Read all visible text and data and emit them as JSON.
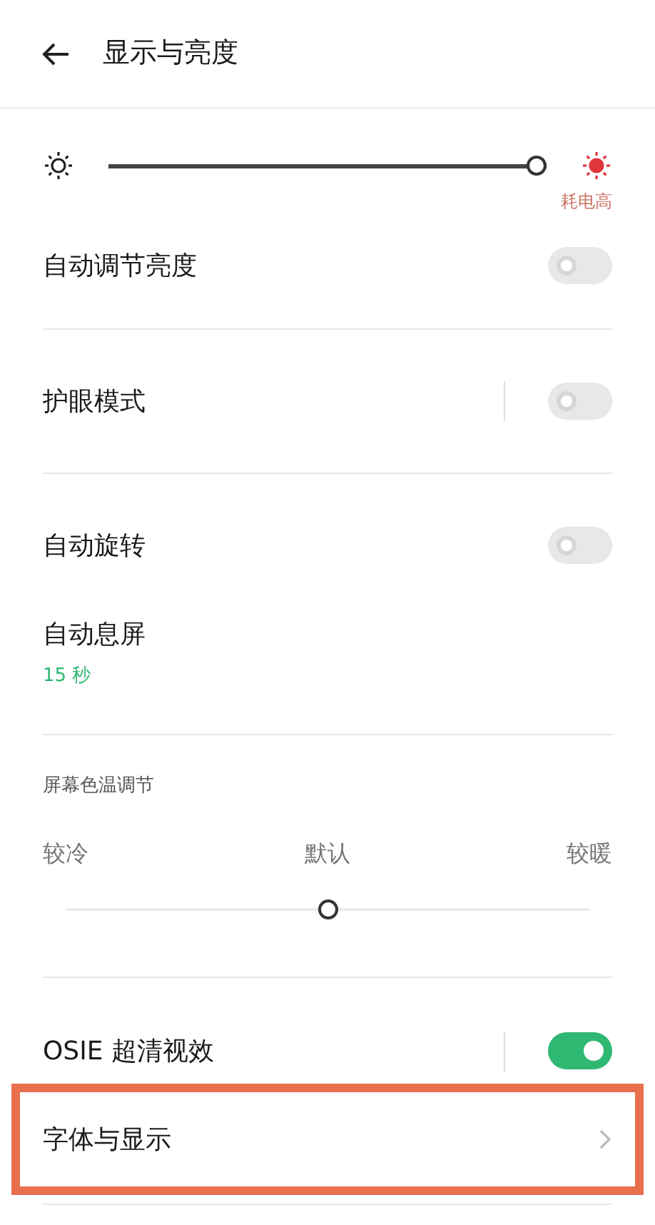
{
  "header": {
    "title": "显示与亮度"
  },
  "brightness": {
    "level": 1.0,
    "note": "耗电高"
  },
  "items": [
    {
      "kind": "toggle",
      "label": "自动调节亮度",
      "on": false,
      "divider": false,
      "rule": true
    },
    {
      "kind": "toggle",
      "label": "护眼模式",
      "on": false,
      "divider": true,
      "rule": true
    },
    {
      "kind": "toggle",
      "label": "自动旋转",
      "on": false,
      "divider": false,
      "rule": false
    },
    {
      "kind": "value",
      "label": "自动息屏",
      "value": "15 秒",
      "rule": true
    },
    {
      "kind": "temperature",
      "title": "屏幕色温调节",
      "labels": [
        "较冷",
        "默认",
        "较暖"
      ],
      "level": 0.5,
      "rule": true
    },
    {
      "kind": "toggle",
      "label": "OSIE 超清视效",
      "on": true,
      "divider": true,
      "rule": false
    },
    {
      "kind": "link",
      "label": "字体与显示",
      "highlighted": true,
      "rule": true
    }
  ]
}
